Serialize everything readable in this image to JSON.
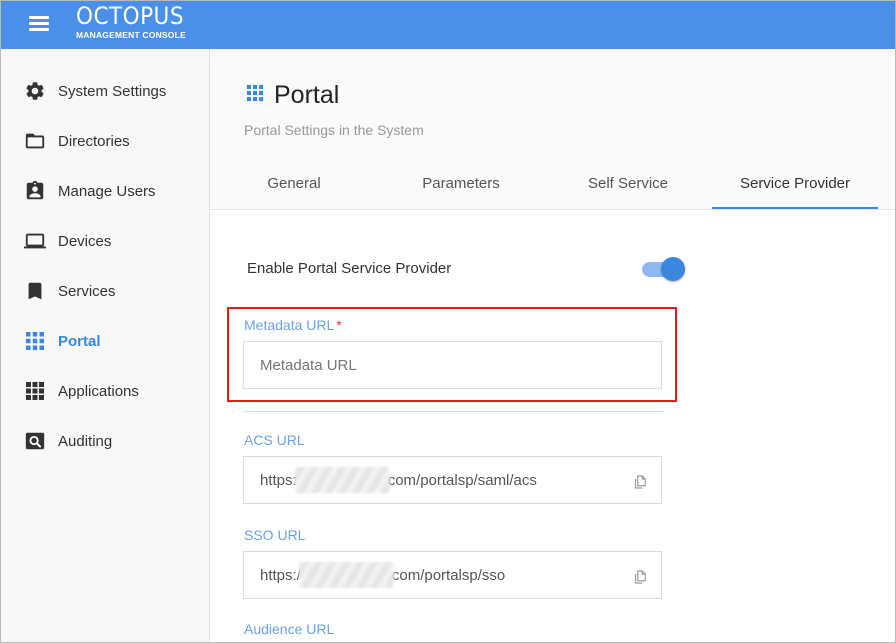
{
  "app": {
    "title": "OCTOPUS",
    "subtitle": "MANAGEMENT CONSOLE",
    "menu_icon": "hamburger-menu-icon"
  },
  "sidebar": {
    "items": [
      {
        "label": "System Settings",
        "icon": "gear-icon"
      },
      {
        "label": "Directories",
        "icon": "folder-icon"
      },
      {
        "label": "Manage Users",
        "icon": "user-badge-icon"
      },
      {
        "label": "Devices",
        "icon": "laptop-icon"
      },
      {
        "label": "Services",
        "icon": "bookmark-icon"
      },
      {
        "label": "Portal",
        "icon": "grid-icon",
        "active": true
      },
      {
        "label": "Applications",
        "icon": "apps-grid-icon"
      },
      {
        "label": "Auditing",
        "icon": "search-box-icon"
      }
    ]
  },
  "page": {
    "title": "Portal",
    "subtitle": "Portal Settings in the System",
    "tabs": [
      {
        "label": "General"
      },
      {
        "label": "Parameters"
      },
      {
        "label": "Self Service"
      },
      {
        "label": "Service Provider",
        "active": true
      }
    ]
  },
  "form": {
    "toggle_label": "Enable Portal Service Provider",
    "toggle_on": true,
    "metadata": {
      "label": "Metadata URL",
      "required_mark": "*",
      "placeholder": "Metadata URL",
      "value": ""
    },
    "acs": {
      "label": "ACS URL",
      "value_prefix": "https:",
      "value_suffix": "com/portalsp/saml/acs"
    },
    "sso": {
      "label": "SSO URL",
      "value_prefix": "https:/",
      "value_suffix": "com/portalsp/sso"
    },
    "audience": {
      "label": "Audience URL"
    }
  },
  "colors": {
    "topbar": "#4a90e8",
    "accent": "#3a86e0",
    "highlight_border": "#dd1c1c",
    "field_label": "#6aa2e6"
  }
}
